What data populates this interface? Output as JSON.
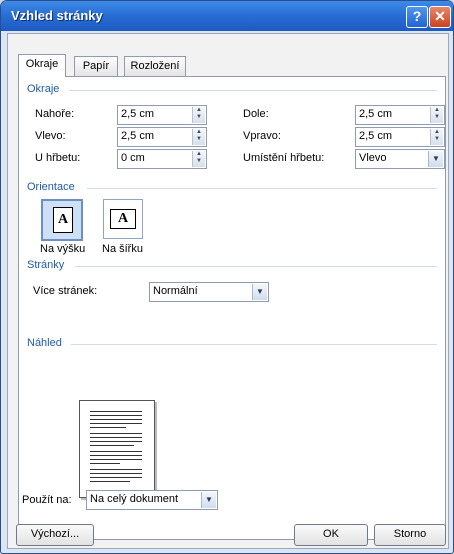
{
  "window": {
    "title": "Vzhled stránky"
  },
  "titlebar": {
    "help": "?",
    "close": "✕"
  },
  "tabs": [
    {
      "label": "Okraje",
      "active": true
    },
    {
      "label": "Papír",
      "active": false
    },
    {
      "label": "Rozložení",
      "active": false
    }
  ],
  "margins": {
    "heading": "Okraje",
    "top": {
      "label": "Nahoře:",
      "value": "2,5 cm"
    },
    "bottom": {
      "label": "Dole:",
      "value": "2,5 cm"
    },
    "left": {
      "label": "Vlevo:",
      "value": "2,5 cm"
    },
    "right": {
      "label": "Vpravo:",
      "value": "2,5 cm"
    },
    "gutter": {
      "label": "U hřbetu:",
      "value": "0 cm"
    },
    "gutter_pos": {
      "label": "Umístění hřbetu:",
      "value": "Vlevo"
    }
  },
  "orientation": {
    "heading": "Orientace",
    "portrait": {
      "label": "Na výšku",
      "glyph": "A",
      "selected": true
    },
    "landscape": {
      "label": "Na šířku",
      "glyph": "A"
    }
  },
  "pages": {
    "heading": "Stránky",
    "multiple": {
      "label": "Více stránek:",
      "value": "Normální"
    }
  },
  "preview": {
    "heading": "Náhled"
  },
  "apply": {
    "label": "Použít na:",
    "value": "Na celý dokument"
  },
  "buttons": {
    "default": "Výchozí...",
    "ok": "OK",
    "cancel": "Storno"
  }
}
